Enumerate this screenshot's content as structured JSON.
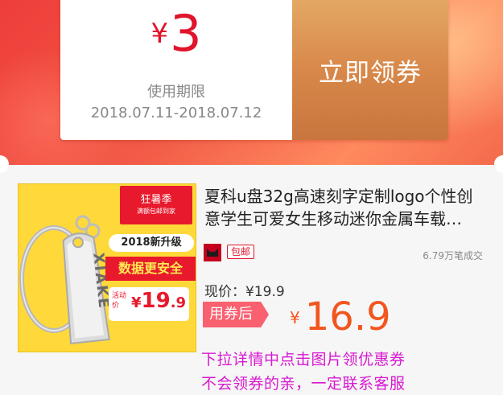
{
  "coupon": {
    "currency": "¥",
    "amount": "3",
    "validity_label": "使用期限",
    "validity_range": "2018.07.11-2018.07.12",
    "claim_label": "立即领券"
  },
  "product": {
    "title": "夏科u盘32g高速刻字定制logo个性创意学生可爱女生移动迷你金属车载…",
    "shop_icon": "tmall-cat-icon",
    "free_shipping": "包邮",
    "sales": "6.79万笔成交",
    "price_label": "现价：¥19.9",
    "after_coupon_label": "用券后",
    "final_currency": "¥",
    "final_price": "16.9"
  },
  "image_text": {
    "badge_main": "狂暑季",
    "badge_sub": "满额包邮到家",
    "upgrade": "2018新升级",
    "safety": "数据更安全",
    "promo_tag": "活动价",
    "promo_currency": "¥",
    "promo_price_int": "19",
    "promo_price_dec": ".9",
    "device_brand": "XIAKE"
  },
  "notices": {
    "line1": "下拉详情中点击图片领优惠券",
    "line2": "不会领券的亲，一定联系客服"
  },
  "colors": {
    "banner_red": "#ee3d3a",
    "coupon_red": "#e0142a",
    "claim_gold": "#d8884a",
    "price_orange": "#f2561f",
    "notice_magenta": "#d818d0"
  }
}
